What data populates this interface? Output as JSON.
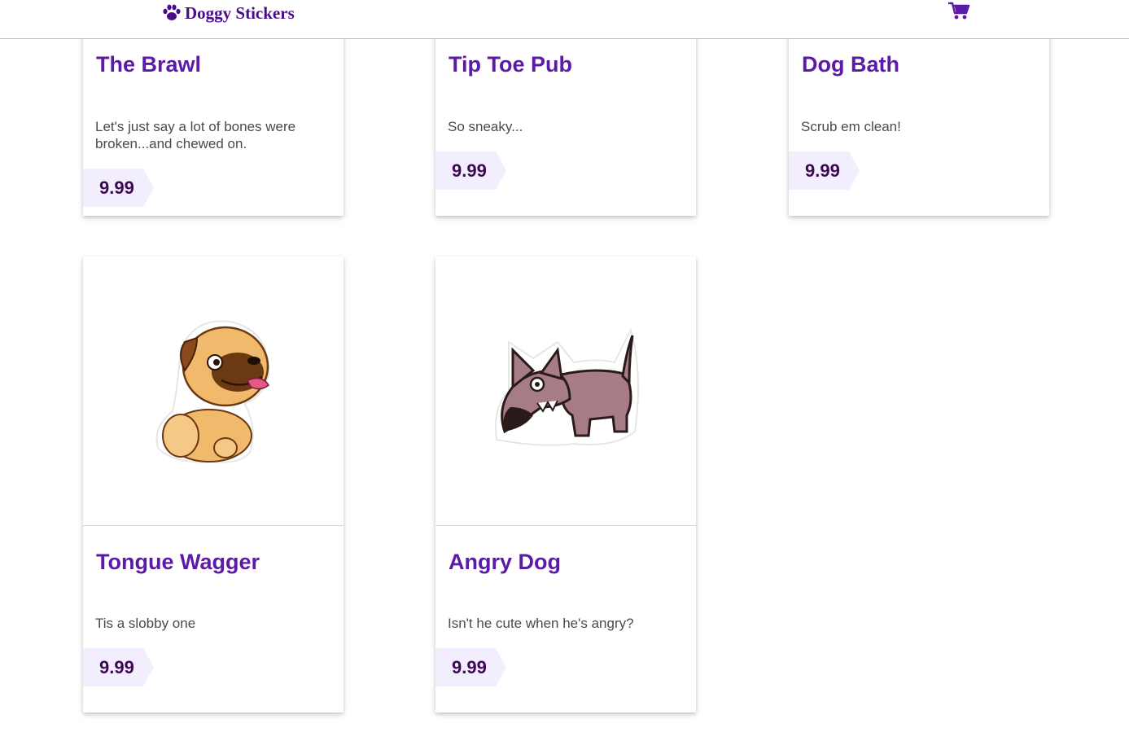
{
  "header": {
    "brand": "Doggy Stickers",
    "brand_icon": "paw-icon",
    "cart_icon": "shopping-cart-icon",
    "accent_color": "#4b0a8c"
  },
  "products": [
    {
      "title": "The Brawl",
      "description": "Let's just say a lot of bones were broken...and chewed on.",
      "price": "9.99"
    },
    {
      "title": "Tip Toe Pub",
      "description": "So sneaky...",
      "price": "9.99"
    },
    {
      "title": "Dog Bath",
      "description": "Scrub em clean!",
      "price": "9.99"
    },
    {
      "title": "Tongue Wagger",
      "description": "Tis a slobby one",
      "price": "9.99",
      "image": "pug-sticker"
    },
    {
      "title": "Angry Dog",
      "description": "Isn't he cute when he's angry?",
      "price": "9.99",
      "image": "angry-dog-sticker"
    }
  ]
}
